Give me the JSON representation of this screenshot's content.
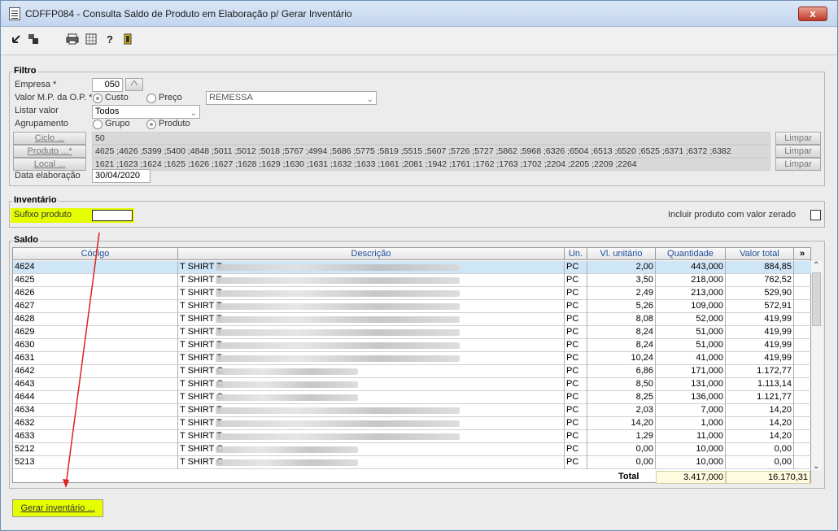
{
  "window": {
    "title": "CDFFP084 - Consulta Saldo de Produto em Elaboração p/ Gerar Inventário",
    "close": "x"
  },
  "filtro": {
    "title": "Filtro",
    "empresa_label": "Empresa *",
    "empresa_value": "050",
    "valor_mp_label": "Valor M.P. da O.P. *",
    "custo_label": "Custo",
    "preco_label": "Preço",
    "remessa_value": "REMESSA",
    "listar_label": "Listar valor",
    "listar_value": "Todos",
    "agrupamento_label": "Agrupamento",
    "grupo_label": "Grupo",
    "produto_label": "Produto",
    "ciclo_btn": "Ciclo ...",
    "ciclo_value": "50",
    "produto_btn": "Produto ...*",
    "produto_value": "4625 ;4626 ;5399 ;5400 ;4848 ;5011 ;5012 ;5018 ;5767 ;4994 ;5686 ;5775 ;5819 ;5515 ;5607 ;5726 ;5727 ;5862 ;5968 ;6326 ;6504 ;6513 ;6520 ;6525 ;6371 ;6372 ;6382",
    "local_btn": "Local ...",
    "local_value": "1621 ;1623 ;1624 ;1625 ;1626 ;1627 ;1628 ;1629 ;1630 ;1631 ;1632 ;1633 ;1661 ;2081 ;1942 ;1761 ;1762 ;1763 ;1702 ;2204 ;2205 ;2209 ;2264",
    "limpar": "Limpar",
    "data_label": "Data elaboração",
    "data_value": "30/04/2020"
  },
  "inventario": {
    "title": "Inventário",
    "sufixo_label": "Sufixo produto",
    "incluir_label": "Incluir produto com valor zerado"
  },
  "saldo": {
    "title": "Saldo",
    "columns": [
      "Código",
      "Descrição",
      "Un.",
      "Vl. unitário",
      "Quantidade",
      "Valor total"
    ],
    "more": "»",
    "rows": [
      {
        "codigo": "4624",
        "desc": "T SHIRT T",
        "un": "PC",
        "vl": "2,00",
        "qtd": "443,000",
        "total": "884,85"
      },
      {
        "codigo": "4625",
        "desc": "T SHIRT T",
        "un": "PC",
        "vl": "3,50",
        "qtd": "218,000",
        "total": "762,52"
      },
      {
        "codigo": "4626",
        "desc": "T SHIRT T",
        "un": "PC",
        "vl": "2,49",
        "qtd": "213,000",
        "total": "529,90"
      },
      {
        "codigo": "4627",
        "desc": "T SHIRT T",
        "un": "PC",
        "vl": "5,26",
        "qtd": "109,000",
        "total": "572,91"
      },
      {
        "codigo": "4628",
        "desc": "T SHIRT T",
        "un": "PC",
        "vl": "8,08",
        "qtd": "52,000",
        "total": "419,99"
      },
      {
        "codigo": "4629",
        "desc": "T SHIRT T",
        "un": "PC",
        "vl": "8,24",
        "qtd": "51,000",
        "total": "419,99"
      },
      {
        "codigo": "4630",
        "desc": "T SHIRT T",
        "un": "PC",
        "vl": "8,24",
        "qtd": "51,000",
        "total": "419,99"
      },
      {
        "codigo": "4631",
        "desc": "T SHIRT T",
        "un": "PC",
        "vl": "10,24",
        "qtd": "41,000",
        "total": "419,99"
      },
      {
        "codigo": "4642",
        "desc": "T SHIRT C",
        "un": "PC",
        "vl": "6,86",
        "qtd": "171,000",
        "total": "1.172,77"
      },
      {
        "codigo": "4643",
        "desc": "T SHIRT C",
        "un": "PC",
        "vl": "8,50",
        "qtd": "131,000",
        "total": "1.113,14"
      },
      {
        "codigo": "4644",
        "desc": "T SHIRT C",
        "un": "PC",
        "vl": "8,25",
        "qtd": "136,000",
        "total": "1.121,77"
      },
      {
        "codigo": "4634",
        "desc": "T SHIRT T",
        "un": "PC",
        "vl": "2,03",
        "qtd": "7,000",
        "total": "14,20"
      },
      {
        "codigo": "4632",
        "desc": "T SHIRT T",
        "un": "PC",
        "vl": "14,20",
        "qtd": "1,000",
        "total": "14,20"
      },
      {
        "codigo": "4633",
        "desc": "T SHIRT T",
        "un": "PC",
        "vl": "1,29",
        "qtd": "11,000",
        "total": "14,20"
      },
      {
        "codigo": "5212",
        "desc": "T SHIRT C",
        "un": "PC",
        "vl": "0,00",
        "qtd": "10,000",
        "total": "0,00"
      },
      {
        "codigo": "5213",
        "desc": "T SHIRT C",
        "un": "PC",
        "vl": "0,00",
        "qtd": "10,000",
        "total": "0,00"
      }
    ],
    "total_label": "Total",
    "total_qtd": "3.417,000",
    "total_valor": "16.170,31"
  },
  "footer": {
    "gerar_btn": "Gerar inventário ..."
  },
  "colors": {
    "highlight": "#e5ff00",
    "annotation_arrow": "#e02020",
    "selected_row": "#cfe6f7"
  }
}
